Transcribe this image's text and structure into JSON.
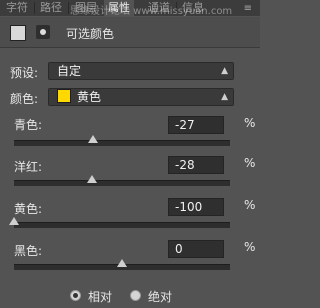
{
  "tabs": [
    {
      "label": "字符"
    },
    {
      "label": "路径"
    },
    {
      "label": "图层"
    },
    {
      "label": "属性"
    },
    {
      "label": "通道"
    },
    {
      "label": "信息"
    }
  ],
  "watermark": "思缘设计论坛 www.missyuan.com",
  "adjustment_title": "可选颜色",
  "preset": {
    "label": "预设:",
    "value": "自定"
  },
  "colors": {
    "label": "颜色:",
    "value": "黄色",
    "swatch": "#ffd800"
  },
  "sliders": [
    {
      "label": "青色:",
      "value": "-27",
      "unit": "%",
      "level": -27
    },
    {
      "label": "洋红:",
      "value": "-28",
      "unit": "%",
      "level": -28
    },
    {
      "label": "黄色:",
      "value": "-100",
      "unit": "%",
      "level": -100
    },
    {
      "label": "黑色:",
      "value": "0",
      "unit": "%",
      "level": 0
    }
  ],
  "mode": {
    "relative": "相对",
    "absolute": "绝对",
    "selected": "relative"
  }
}
